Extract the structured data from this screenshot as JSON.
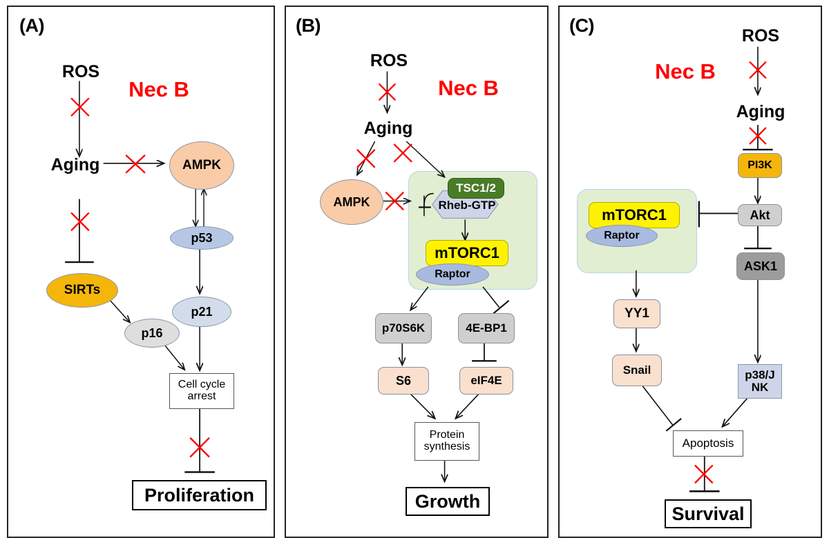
{
  "figure": {
    "title": "Nec B modulation of aging-related signaling pathways",
    "background": "#ffffff",
    "accent_red": "#FF0000",
    "panel_border": "#222222"
  },
  "panels": [
    {
      "id": "A",
      "label": "(A)",
      "inhibitor_label": "Nec B",
      "nodes": [
        {
          "key": "ros",
          "label": "ROS",
          "shape": "plain",
          "fill": "none",
          "text_color": "#000000"
        },
        {
          "key": "aging",
          "label": "Aging",
          "shape": "plain",
          "fill": "none",
          "text_color": "#000000"
        },
        {
          "key": "ampk",
          "label": "AMPK",
          "shape": "circle",
          "fill": "#F9CBA7",
          "text_color": "#000000"
        },
        {
          "key": "p53",
          "label": "p53",
          "shape": "ellipse",
          "fill": "#B6C7E4",
          "text_color": "#000000"
        },
        {
          "key": "p21",
          "label": "p21",
          "shape": "ellipse",
          "fill": "#D3DCEA",
          "text_color": "#000000"
        },
        {
          "key": "sirts",
          "label": "SIRTs",
          "shape": "ellipse",
          "fill": "#F5B60B",
          "text_color": "#000000"
        },
        {
          "key": "p16",
          "label": "p16",
          "shape": "ellipse",
          "fill": "#DEDEDE",
          "text_color": "#000000"
        },
        {
          "key": "arrest",
          "label": "Cell cycle arrest",
          "shape": "rect",
          "fill": "#FFFFFF",
          "text_color": "#000000"
        },
        {
          "key": "prolif",
          "label": "Proliferation",
          "shape": "rect-bold",
          "fill": "#FFFFFF",
          "text_color": "#000000"
        }
      ],
      "edges": [
        {
          "from": "ros",
          "to": "aging",
          "type": "arrow",
          "blocked": true
        },
        {
          "from": "aging",
          "to": "ampk",
          "type": "arrow",
          "blocked": true
        },
        {
          "from": "aging",
          "to": "sirts",
          "type": "inhibition",
          "blocked": true
        },
        {
          "from": "ampk",
          "to": "p53",
          "type": "arrow",
          "blocked": false
        },
        {
          "from": "p53",
          "to": "ampk",
          "type": "arrow",
          "blocked": false
        },
        {
          "from": "p53",
          "to": "p21",
          "type": "arrow",
          "blocked": false
        },
        {
          "from": "sirts",
          "to": "p16",
          "type": "arrow",
          "blocked": false
        },
        {
          "from": "p16",
          "to": "arrest",
          "type": "arrow",
          "blocked": false
        },
        {
          "from": "p21",
          "to": "arrest",
          "type": "arrow",
          "blocked": false
        },
        {
          "from": "arrest",
          "to": "prolif",
          "type": "inhibition",
          "blocked": true
        }
      ]
    },
    {
      "id": "B",
      "label": "(B)",
      "inhibitor_label": "Nec B",
      "nodes": [
        {
          "key": "ros",
          "label": "ROS",
          "shape": "plain",
          "fill": "none",
          "text_color": "#000000"
        },
        {
          "key": "aging",
          "label": "Aging",
          "shape": "plain",
          "fill": "none",
          "text_color": "#000000"
        },
        {
          "key": "ampk",
          "label": "AMPK",
          "shape": "circle",
          "fill": "#F9CBA7",
          "text_color": "#000000"
        },
        {
          "key": "tsc",
          "label": "TSC1/2",
          "shape": "rrect",
          "fill": "#4A7C28",
          "text_color": "#FFFFFF"
        },
        {
          "key": "rheb",
          "label": "Rheb-GTP",
          "shape": "hexagon",
          "fill": "#CFD5E8",
          "text_color": "#000000"
        },
        {
          "key": "mtorc1",
          "label": "mTORC1",
          "shape": "rrect",
          "fill": "#FFF200",
          "text_color": "#000000"
        },
        {
          "key": "raptor",
          "label": "Raptor",
          "shape": "ellipse",
          "fill": "#A9BADF",
          "text_color": "#000000"
        },
        {
          "key": "p70s6k",
          "label": "p70S6K",
          "shape": "rrect",
          "fill": "#CFCFCF",
          "text_color": "#000000"
        },
        {
          "key": "s6",
          "label": "S6",
          "shape": "rrect",
          "fill": "#FAE0CE",
          "text_color": "#000000"
        },
        {
          "key": "ebp1",
          "label": "4E-BP1",
          "shape": "rrect",
          "fill": "#CFCFCF",
          "text_color": "#000000"
        },
        {
          "key": "eif4e",
          "label": "eIF4E",
          "shape": "rrect",
          "fill": "#FAE0CE",
          "text_color": "#000000"
        },
        {
          "key": "protsyn",
          "label": "Protein synthesis",
          "shape": "rect",
          "fill": "#FFFFFF",
          "text_color": "#000000"
        },
        {
          "key": "growth",
          "label": "Growth",
          "shape": "rect-bold",
          "fill": "#FFFFFF",
          "text_color": "#000000"
        }
      ],
      "compartment_fill": "#E2EED2",
      "edges": [
        {
          "from": "ros",
          "to": "aging",
          "type": "arrow",
          "blocked": true
        },
        {
          "from": "aging",
          "to": "ampk",
          "type": "arrow",
          "blocked": true
        },
        {
          "from": "aging",
          "to": "tsc",
          "type": "arrow",
          "blocked": true
        },
        {
          "from": "ampk",
          "to": "tsc",
          "type": "arrow",
          "blocked": true
        },
        {
          "from": "tsc",
          "to": "rheb",
          "type": "inhibition",
          "blocked": false
        },
        {
          "from": "rheb",
          "to": "mtorc1",
          "type": "arrow",
          "blocked": false
        },
        {
          "from": "mtorc1",
          "to": "p70s6k",
          "type": "arrow",
          "blocked": false
        },
        {
          "from": "mtorc1",
          "to": "ebp1",
          "type": "inhibition",
          "blocked": false
        },
        {
          "from": "p70s6k",
          "to": "s6",
          "type": "arrow",
          "blocked": false
        },
        {
          "from": "ebp1",
          "to": "eif4e",
          "type": "inhibition",
          "blocked": false
        },
        {
          "from": "s6",
          "to": "protsyn",
          "type": "arrow",
          "blocked": false
        },
        {
          "from": "eif4e",
          "to": "protsyn",
          "type": "arrow",
          "blocked": false
        },
        {
          "from": "protsyn",
          "to": "growth",
          "type": "arrow",
          "blocked": false
        }
      ]
    },
    {
      "id": "C",
      "label": "(C)",
      "inhibitor_label": "Nec B",
      "nodes": [
        {
          "key": "ros",
          "label": "ROS",
          "shape": "plain",
          "fill": "none",
          "text_color": "#000000"
        },
        {
          "key": "aging",
          "label": "Aging",
          "shape": "plain",
          "fill": "none",
          "text_color": "#000000"
        },
        {
          "key": "pi3k",
          "label": "PI3K",
          "shape": "rrect",
          "fill": "#F5B60B",
          "text_color": "#000000"
        },
        {
          "key": "akt",
          "label": "Akt",
          "shape": "rrect",
          "fill": "#CFCFCF",
          "text_color": "#000000"
        },
        {
          "key": "ask1",
          "label": "ASK1",
          "shape": "rrect",
          "fill": "#9C9C9C",
          "text_color": "#000000"
        },
        {
          "key": "p38jnk",
          "label": "p38/JNK",
          "shape": "rect",
          "fill": "#CFD5E8",
          "text_color": "#000000"
        },
        {
          "key": "mtorc1",
          "label": "mTORC1",
          "shape": "rrect",
          "fill": "#FFF200",
          "text_color": "#000000"
        },
        {
          "key": "raptor",
          "label": "Raptor",
          "shape": "ellipse",
          "fill": "#A9BADF",
          "text_color": "#000000"
        },
        {
          "key": "yy1",
          "label": "YY1",
          "shape": "rrect",
          "fill": "#FAE0CE",
          "text_color": "#000000"
        },
        {
          "key": "snail",
          "label": "Snail",
          "shape": "rrect",
          "fill": "#FAE0CE",
          "text_color": "#000000"
        },
        {
          "key": "apoptosis",
          "label": "Apoptosis",
          "shape": "rect",
          "fill": "#FFFFFF",
          "text_color": "#000000"
        },
        {
          "key": "survival",
          "label": "Survival",
          "shape": "rect-bold",
          "fill": "#FFFFFF",
          "text_color": "#000000"
        }
      ],
      "compartment_fill": "#E2EED2",
      "edges": [
        {
          "from": "ros",
          "to": "aging",
          "type": "arrow",
          "blocked": true
        },
        {
          "from": "aging",
          "to": "pi3k",
          "type": "inhibition",
          "blocked": true
        },
        {
          "from": "pi3k",
          "to": "akt",
          "type": "arrow",
          "blocked": false
        },
        {
          "from": "akt",
          "to": "mtorc1",
          "type": "inhibition",
          "blocked": false
        },
        {
          "from": "akt",
          "to": "ask1",
          "type": "inhibition",
          "blocked": false
        },
        {
          "from": "ask1",
          "to": "p38jnk",
          "type": "arrow",
          "blocked": false
        },
        {
          "from": "mtorc1",
          "to": "yy1",
          "type": "arrow",
          "blocked": false
        },
        {
          "from": "yy1",
          "to": "snail",
          "type": "arrow",
          "blocked": false
        },
        {
          "from": "snail",
          "to": "apoptosis",
          "type": "inhibition",
          "blocked": false
        },
        {
          "from": "p38jnk",
          "to": "apoptosis",
          "type": "arrow",
          "blocked": false
        },
        {
          "from": "apoptosis",
          "to": "survival",
          "type": "inhibition",
          "blocked": true
        }
      ]
    }
  ],
  "labels": {
    "A": {
      "panel": "(A)",
      "necb": "Nec B",
      "ros": "ROS",
      "aging": "Aging",
      "ampk": "AMPK",
      "p53": "p53",
      "p21": "p21",
      "sirts": "SIRTs",
      "p16": "p16",
      "arrest_line1": "Cell cycle",
      "arrest_line2": "arrest",
      "prolif": "Proliferation"
    },
    "B": {
      "panel": "(B)",
      "necb": "Nec B",
      "ros": "ROS",
      "aging": "Aging",
      "ampk": "AMPK",
      "tsc": "TSC1/2",
      "rheb": "Rheb-GTP",
      "mtorc1": "mTORC1",
      "raptor": "Raptor",
      "p70s6k": "p70S6K",
      "s6": "S6",
      "ebp1": "4E-BP1",
      "eif4e": "eIF4E",
      "prot_line1": "Protein",
      "prot_line2": "synthesis",
      "growth": "Growth"
    },
    "C": {
      "panel": "(C)",
      "necb": "Nec B",
      "ros": "ROS",
      "aging": "Aging",
      "pi3k": "PI3K",
      "akt": "Akt",
      "ask1": "ASK1",
      "p38_line1": "p38/J",
      "p38_line2": "NK",
      "mtorc1": "mTORC1",
      "raptor": "Raptor",
      "yy1": "YY1",
      "snail": "Snail",
      "apoptosis": "Apoptosis",
      "survival": "Survival"
    }
  }
}
